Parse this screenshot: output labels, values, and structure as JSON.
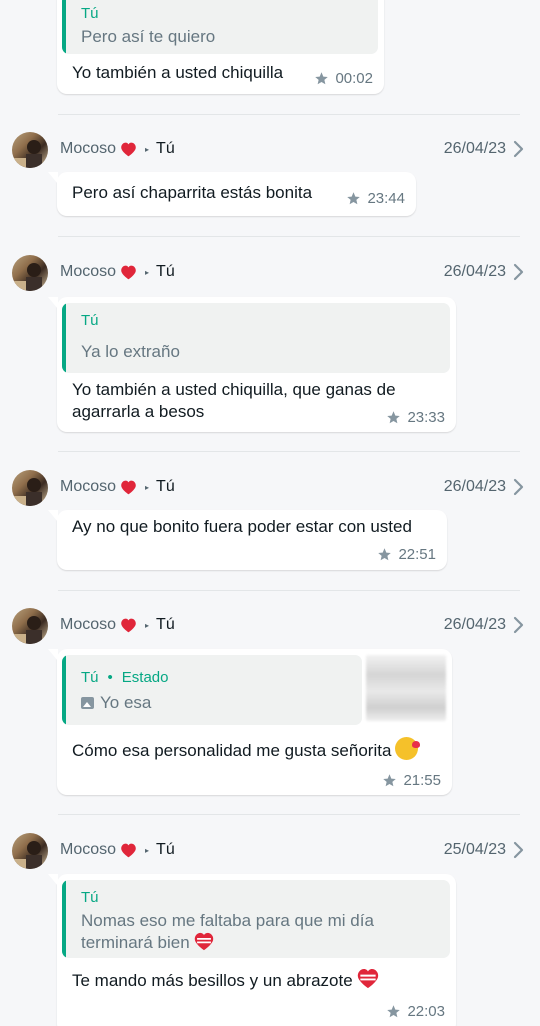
{
  "first_message": {
    "quote_author": "Tú",
    "quote_text": "Pero así te quiero",
    "text": "Yo también a usted chiquilla",
    "time": "00:02"
  },
  "starred": [
    {
      "sender": "Mocoso",
      "recipient": "Tú",
      "date": "26/04/23",
      "text": "Pero así chaparrita estás bonita",
      "time": "23:44"
    },
    {
      "sender": "Mocoso",
      "recipient": "Tú",
      "date": "26/04/23",
      "quote_author": "Tú",
      "quote_text": "Ya lo extraño",
      "text_line1": "Yo también a usted chiquilla, que ganas de",
      "text_line2": "agarrarla a besos",
      "time": "23:33"
    },
    {
      "sender": "Mocoso",
      "recipient": "Tú",
      "date": "26/04/23",
      "text": "Ay no que bonito fuera poder estar con usted",
      "time": "22:51"
    },
    {
      "sender": "Mocoso",
      "recipient": "Tú",
      "date": "26/04/23",
      "quote_author": "Tú",
      "quote_tag": "Estado",
      "quote_text": "Yo esa",
      "text": "Cómo esa personalidad me gusta señorita",
      "time": "21:55"
    },
    {
      "sender": "Mocoso",
      "recipient": "Tú",
      "date": "25/04/23",
      "quote_author": "Tú",
      "quote_text_line1": "Nomas eso me faltaba para que mi día",
      "quote_text_line2": "terminará bien",
      "text": "Te mando más besillos y un abrazote",
      "time": "22:03"
    }
  ],
  "icons": {
    "star": "star-icon",
    "chevron": "chevron-right-icon",
    "heart": "red-heart-icon",
    "sent_to": "triangle-right-icon"
  },
  "colors": {
    "accent": "#06a884",
    "background": "#f6f7f9",
    "bubble": "#ffffff",
    "quote_bg": "#f0f2f1",
    "meta": "#667781"
  }
}
